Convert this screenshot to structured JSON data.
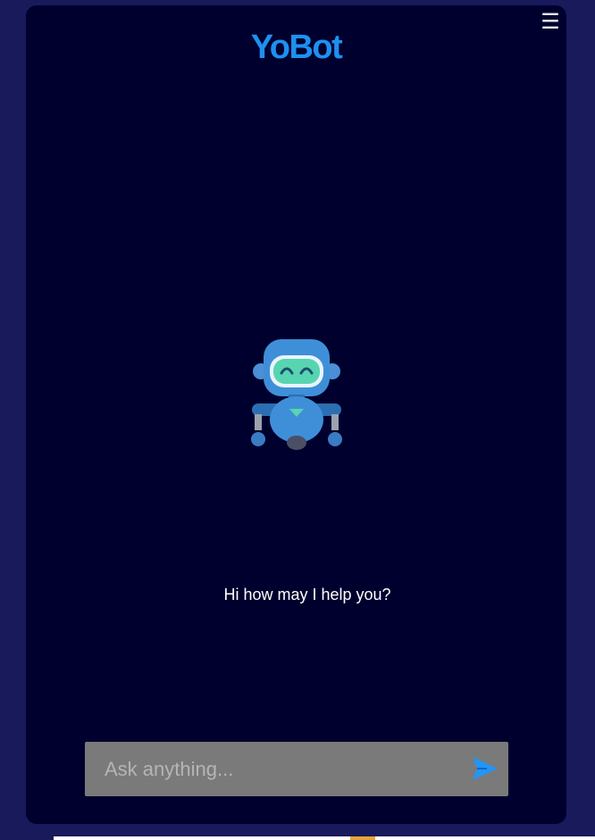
{
  "app": {
    "title": "YoBot"
  },
  "chat": {
    "greeting": "Hi how may I help you?",
    "input_placeholder": "Ask anything...",
    "input_value": ""
  },
  "icons": {
    "menu": "hamburger-menu-icon",
    "send": "send-icon",
    "robot": "robot-icon"
  },
  "colors": {
    "page_background": "#191a5c",
    "panel_background": "#00002e",
    "brand": "#1e90f0",
    "input_background": "#7a7a7a",
    "send_accent": "#2196f3"
  }
}
